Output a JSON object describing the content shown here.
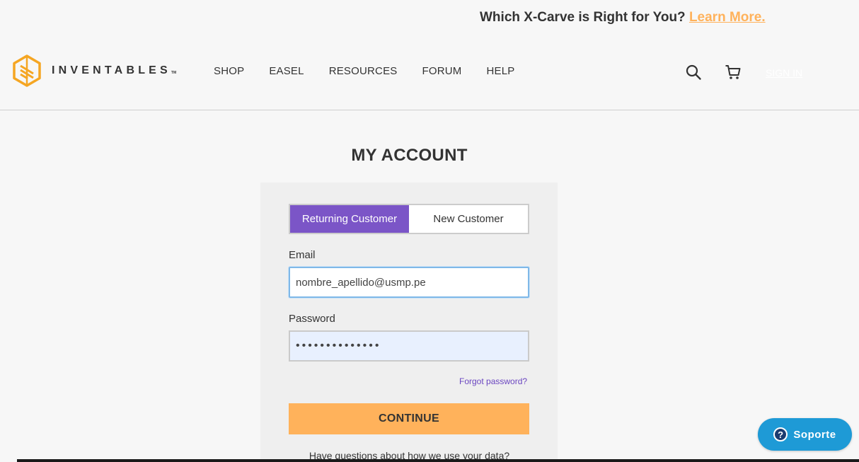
{
  "promo": {
    "text": "Which X-Carve is Right for You?",
    "link": "Learn More."
  },
  "brand": {
    "name": "INVENTABLES",
    "trademark": "TM",
    "logo_color": "#f5a623"
  },
  "nav": {
    "items": [
      "SHOP",
      "EASEL",
      "RESOURCES",
      "FORUM",
      "HELP"
    ]
  },
  "header": {
    "search_icon": "search-icon",
    "cart_icon": "cart-icon",
    "signin_label": "SIGN IN"
  },
  "page": {
    "title": "MY ACCOUNT"
  },
  "login": {
    "tabs": [
      "Returning Customer",
      "New Customer"
    ],
    "active_tab": "Returning Customer",
    "email_label": "Email",
    "email_value": "nombre_apellido@usmp.pe",
    "password_label": "Password",
    "password_value": "••••••••••••••",
    "forgot_label": "Forgot password?",
    "continue_label": "CONTINUE",
    "questions_label": "Have questions about how we use your data?"
  },
  "support": {
    "label": "Soporte",
    "icon": "question-icon"
  },
  "colors": {
    "accent_purple": "#7b55c7",
    "accent_orange": "#ffb25b",
    "support_blue": "#1e9ad6"
  }
}
